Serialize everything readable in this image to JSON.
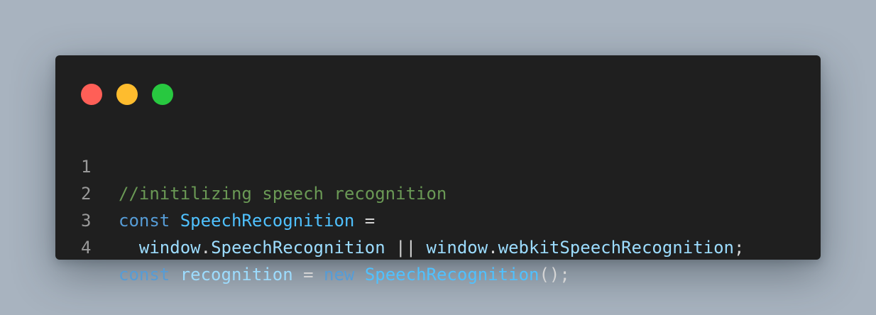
{
  "colors": {
    "background": "#a8b3bf",
    "window": "#1f1f1f",
    "close": "#ff5f57",
    "minimize": "#febc2e",
    "maximize": "#28c840",
    "comment": "#6a9955",
    "keyword": "#569cd6",
    "class": "#4fc1ff",
    "variable": "#9cdcfe",
    "plain": "#d4d4d4",
    "line_number": "#9a9a9a"
  },
  "window_controls": [
    {
      "name": "close-dot",
      "color": "#ff5f57"
    },
    {
      "name": "minimize-dot",
      "color": "#febc2e"
    },
    {
      "name": "maximize-dot",
      "color": "#28c840"
    }
  ],
  "code": {
    "lines": [
      {
        "number": "1",
        "tokens": [
          {
            "text": "//initilizing speech recognition",
            "kind": "comment"
          }
        ]
      },
      {
        "number": "2",
        "tokens": [
          {
            "text": "const",
            "kind": "keyword"
          },
          {
            "text": " ",
            "kind": "plain"
          },
          {
            "text": "SpeechRecognition",
            "kind": "class"
          },
          {
            "text": " =",
            "kind": "plain"
          }
        ]
      },
      {
        "number": "3",
        "tokens": [
          {
            "text": "  ",
            "kind": "plain"
          },
          {
            "text": "window",
            "kind": "var"
          },
          {
            "text": ".",
            "kind": "plain"
          },
          {
            "text": "SpeechRecognition",
            "kind": "var"
          },
          {
            "text": " || ",
            "kind": "plain"
          },
          {
            "text": "window",
            "kind": "var"
          },
          {
            "text": ".",
            "kind": "plain"
          },
          {
            "text": "webkitSpeechRecognition",
            "kind": "var"
          },
          {
            "text": ";",
            "kind": "plain"
          }
        ]
      },
      {
        "number": "4",
        "tokens": [
          {
            "text": "const",
            "kind": "keyword"
          },
          {
            "text": " ",
            "kind": "plain"
          },
          {
            "text": "recognition",
            "kind": "var"
          },
          {
            "text": " = ",
            "kind": "plain"
          },
          {
            "text": "new",
            "kind": "keyword"
          },
          {
            "text": " ",
            "kind": "plain"
          },
          {
            "text": "SpeechRecognition",
            "kind": "func"
          },
          {
            "text": "();",
            "kind": "plain"
          }
        ]
      }
    ]
  }
}
